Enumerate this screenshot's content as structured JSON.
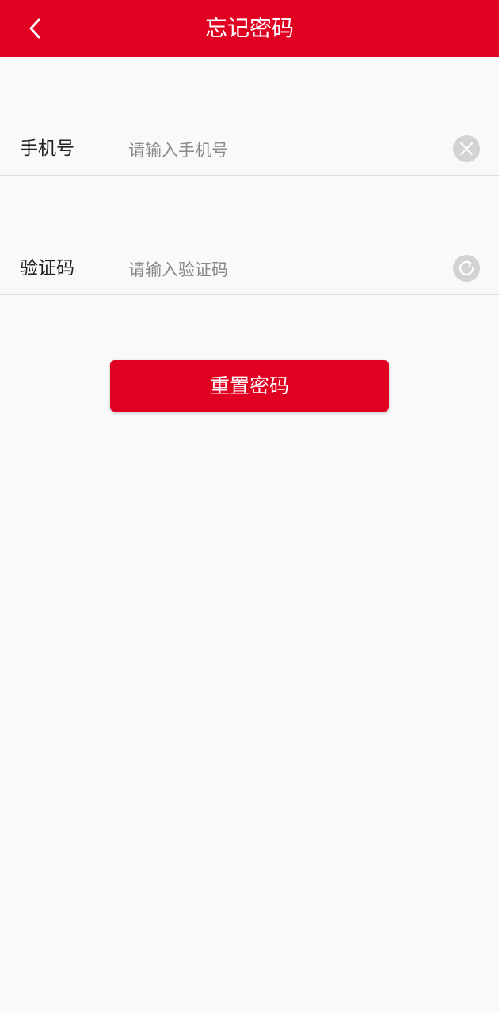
{
  "header": {
    "title": "忘记密码",
    "back_icon": "chevron-left-icon",
    "background_color": "#e00022"
  },
  "form": {
    "phone": {
      "label": "手机号",
      "placeholder": "请输入手机号",
      "value": "",
      "action_icon": "clear-icon"
    },
    "code": {
      "label": "验证码",
      "placeholder": "请输入验证码",
      "value": "",
      "action_icon": "refresh-icon"
    }
  },
  "actions": {
    "reset_label": "重置密码",
    "button_color": "#e00022"
  }
}
